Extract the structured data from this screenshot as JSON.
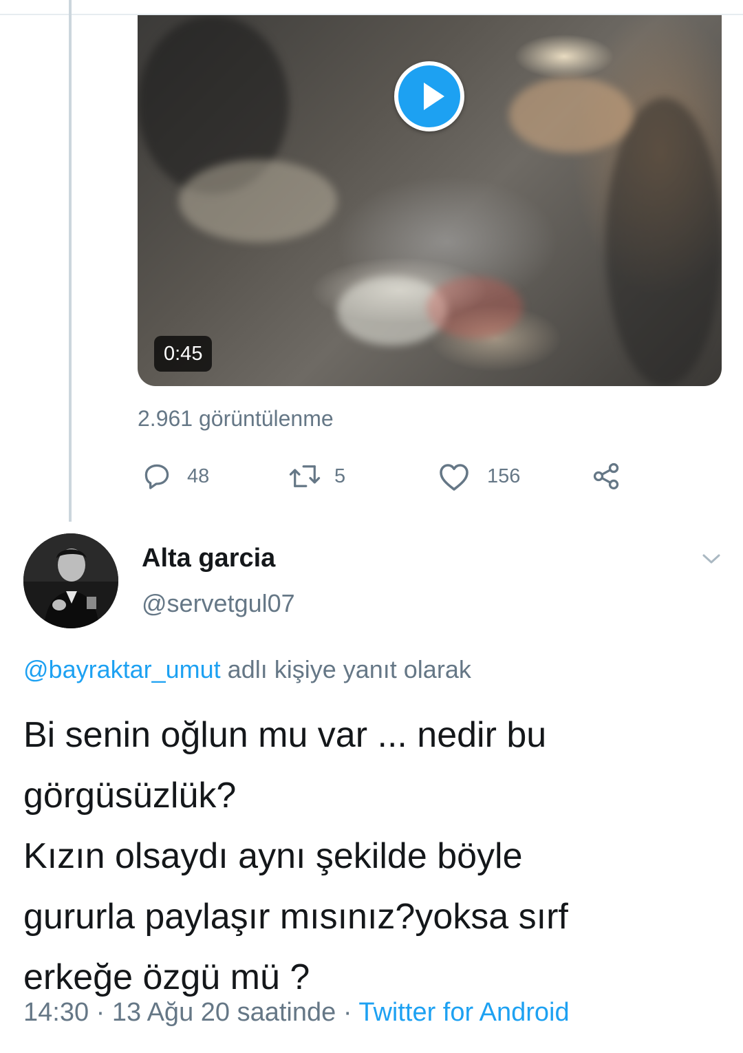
{
  "video": {
    "duration": "0:45",
    "views": "2.961 görüntülenme"
  },
  "actions": {
    "replies": "48",
    "retweets": "5",
    "likes": "156"
  },
  "reply_tweet": {
    "display_name": "Alta garcia",
    "handle": "@servetgul07",
    "reply_to_mention": "@bayraktar_umut",
    "reply_to_suffix": " adlı kişiye yanıt olarak",
    "text_lines": [
      "Bi senin oğlun mu var ... nedir bu",
      "görgüsüzlük?",
      "Kızın olsaydı aynı şekilde böyle",
      "gururla paylaşır mısınız?yoksa sırf",
      "erkeğe özgü mü ?"
    ],
    "timestamp": "14:30 · 13 Ağu 20 saatinde · ",
    "source": "Twitter for Android"
  },
  "icons": {
    "reply": "speech-bubble-icon",
    "retweet": "retweet-arrows-icon",
    "like": "heart-icon",
    "share": "share-icon",
    "menu": "chevron-down-icon",
    "play": "play-icon"
  },
  "colors": {
    "accent": "#1da1f2",
    "secondary_text": "#657786",
    "primary_text": "#14171a",
    "thread_line": "#ccd6dd"
  }
}
